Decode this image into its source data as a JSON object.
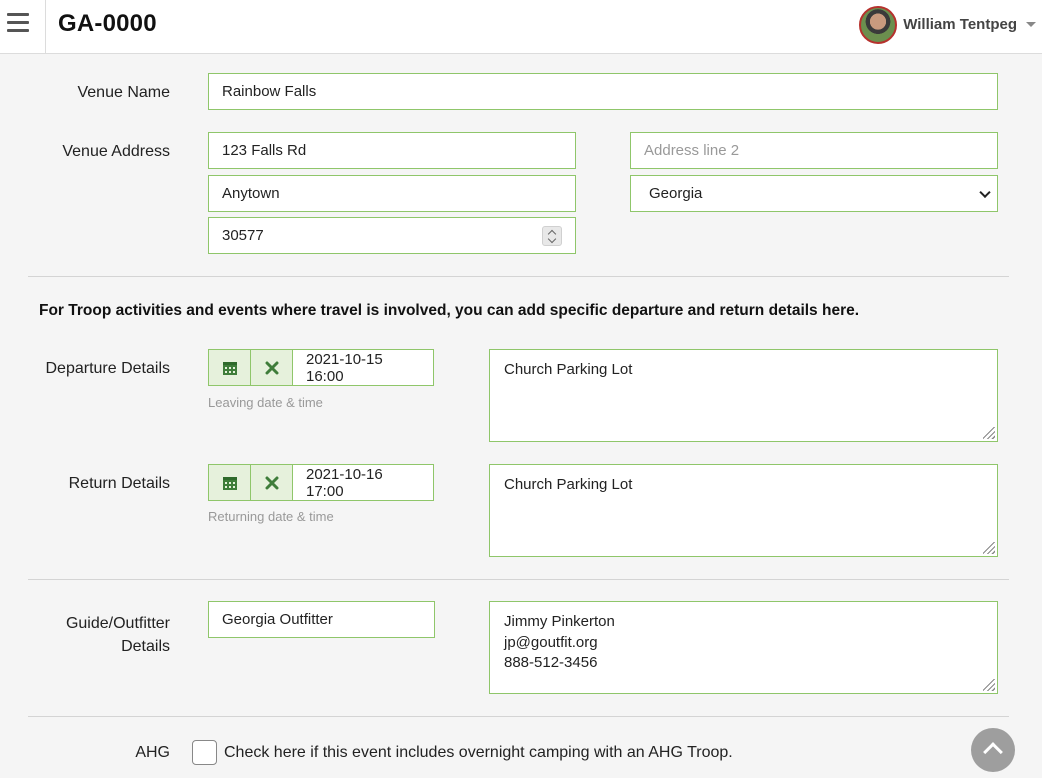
{
  "header": {
    "title": "GA-0000",
    "user_name": "William Tentpeg",
    "menu_icon": "hamburger-menu-icon",
    "user_menu_icon": "caret-down-icon"
  },
  "venue": {
    "name_label": "Venue Name",
    "name_value": "Rainbow Falls",
    "address_label": "Venue Address",
    "address_line1": "123 Falls Rd",
    "address_line2_placeholder": "Address line 2",
    "city": "Anytown",
    "state": "Georgia",
    "zip": "30577"
  },
  "travel": {
    "notice": "For Troop activities and events where travel is involved, you can add specific departure and return details here.",
    "departure_label": "Departure Details",
    "departure_datetime": "2021-10-15 16:00",
    "departure_help": "Leaving date & time",
    "departure_location": "Church Parking Lot",
    "return_label": "Return Details",
    "return_datetime": "2021-10-16 17:00",
    "return_help": "Returning date & time",
    "return_location": "Church Parking Lot",
    "calendar_icon": "calendar-icon",
    "clear_icon": "clear-x-icon"
  },
  "guide": {
    "label_line1": "Guide/Outfitter",
    "label_line2": "Details",
    "name": "Georgia Outfitter",
    "contact_lines": [
      "Jimmy Pinkerton",
      "jp@goutfit.org",
      "888-512-3456"
    ]
  },
  "ahg": {
    "label": "AHG",
    "checkbox_label": "Check here if this event includes overnight camping with an AHG Troop.",
    "checked": false
  },
  "colors": {
    "accent_border": "#8fc66a",
    "button_green": "#3f7d3a"
  }
}
